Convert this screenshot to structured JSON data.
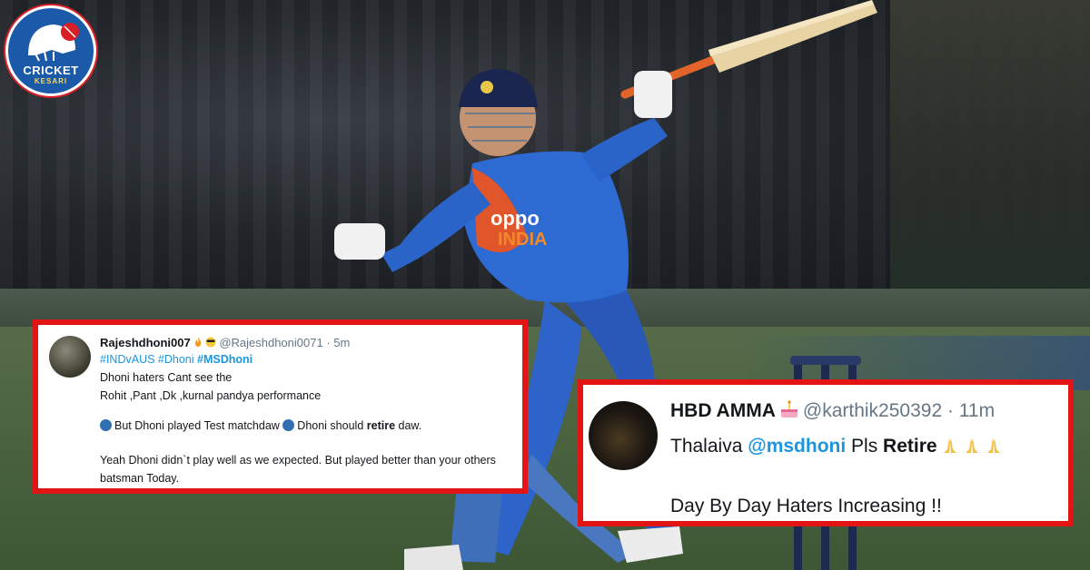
{
  "logo": {
    "line1": "CRICKET",
    "line2": "KESARI"
  },
  "jersey": {
    "sponsor": "oppo",
    "country": "INDIA"
  },
  "tweet_left": {
    "display_name": "Rajeshdhoni007",
    "handle": "@Rajeshdhoni0071",
    "time": "· 5m",
    "hashtags": "#INDvAUS #Dhoni ",
    "hashtag_bold": "#MSDhoni",
    "line1": "Dhoni haters Cant see the",
    "line2": "Rohit ,Pant ,Dk ,kurnal pandya performance",
    "line3a": "But Dhoni played Test matchdaw ",
    "line3b": "Dhoni should ",
    "line3c": "retire",
    "line3d": " daw.",
    "line4": "Yeah Dhoni didn`t  play well as we expected. But played better than your others",
    "line5": "batsman Today."
  },
  "tweet_right": {
    "display_name": "HBD AMMA",
    "handle": "@karthik250392",
    "time": "· 11m",
    "body_prefix": "Thalaiva ",
    "mention": "@msdhoni",
    "body_mid": " Pls ",
    "body_bold": "Retire",
    "line2": "Day By Day Haters Increasing !!"
  },
  "colors": {
    "highlight_border": "#e31414",
    "link_blue": "#1b95e0"
  }
}
